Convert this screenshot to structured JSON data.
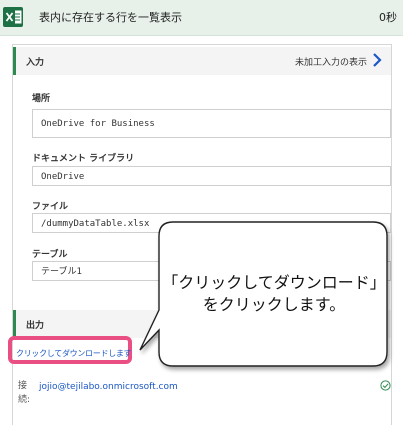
{
  "header": {
    "title": "表内に存在する行を一覧表示",
    "duration": "0秒"
  },
  "input_section": {
    "label": "入力",
    "raw_link": "未加工入力の表示"
  },
  "fields": [
    {
      "label": "場所",
      "value": "OneDrive for Business"
    },
    {
      "label": "ドキュメント ライブラリ",
      "value": "OneDrive"
    },
    {
      "label": "ファイル",
      "value": "/dummyDataTable.xlsx"
    },
    {
      "label": "テーブル",
      "value": "テーブル1"
    }
  ],
  "output_section": {
    "label": "出力",
    "download_link": "クリックしてダウンロードします"
  },
  "connection": {
    "label": "接続:",
    "email": "jojio@tejilabo.onmicrosoft.com"
  },
  "callout": {
    "line1": "「クリックしてダウンロード」",
    "line2": "をクリックします。"
  },
  "colors": {
    "accent_green": "#2d8a4e",
    "highlight_pink": "#ea4f83",
    "link_blue": "#1a57c6"
  }
}
